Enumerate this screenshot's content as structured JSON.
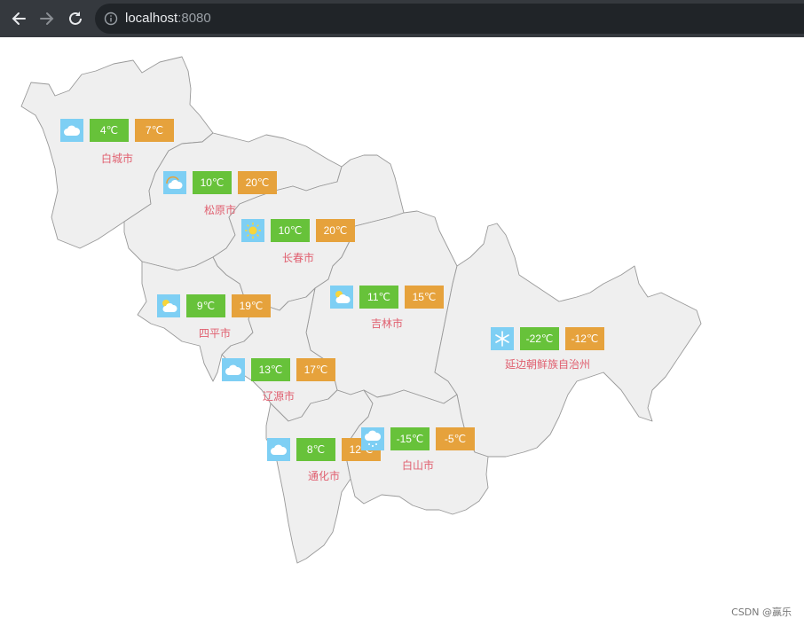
{
  "browser": {
    "url_host": "localhost",
    "url_port": ":8080"
  },
  "map": {
    "region_fill": "#efefef",
    "border_color": "#999999",
    "min_color": "#67c23a",
    "max_color": "#e6a23c",
    "icon_bg": "#7ecff4",
    "label_color": "#e05f6f",
    "cities": [
      {
        "name": "白城市",
        "min": "4℃",
        "max": "7℃",
        "icon": "cloud-icon"
      },
      {
        "name": "松原市",
        "min": "10℃",
        "max": "20℃",
        "icon": "cloud-rainbow-icon"
      },
      {
        "name": "长春市",
        "min": "10℃",
        "max": "20℃",
        "icon": "sun-icon"
      },
      {
        "name": "吉林市",
        "min": "11℃",
        "max": "15℃",
        "icon": "partly-cloudy-icon"
      },
      {
        "name": "四平市",
        "min": "9℃",
        "max": "19℃",
        "icon": "partly-cloudy-icon"
      },
      {
        "name": "延边朝鲜族自治州",
        "min": "-22℃",
        "max": "-12℃",
        "icon": "snowflake-icon"
      },
      {
        "name": "辽源市",
        "min": "13℃",
        "max": "17℃",
        "icon": "cloud-icon"
      },
      {
        "name": "通化市",
        "min": "8℃",
        "max": "12℃",
        "icon": "cloud-icon"
      },
      {
        "name": "白山市",
        "min": "-15℃",
        "max": "-5℃",
        "icon": "snow-cloud-icon"
      }
    ]
  },
  "watermark": "CSDN @赢乐"
}
